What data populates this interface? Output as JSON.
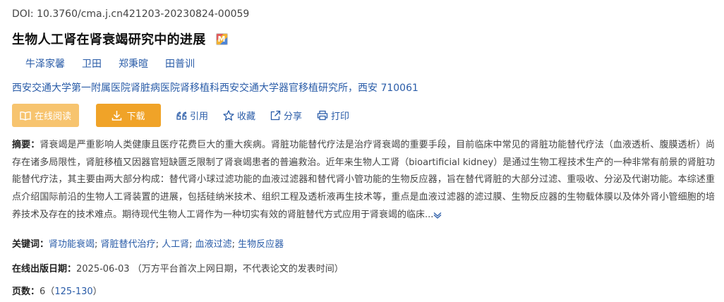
{
  "doi": "DOI: 10.3760/cma.j.cn421203-20230824-00059",
  "title": "生物人工肾在肾衰竭研究中的进展",
  "badge_letter": "M",
  "authors": [
    "牛泽家馨",
    "卫田",
    "郑秉暄",
    "田普训"
  ],
  "affiliation": "西安交通大学第一附属医院肾脏病医院肾移植科西安交通大学器官移植研究所，西安   710061",
  "actions": {
    "read": "在线阅读",
    "download": "下载",
    "cite": "引用",
    "favorite": "收藏",
    "share": "分享",
    "print": "打印"
  },
  "abstract": {
    "label": "摘要：",
    "text": "肾衰竭是严重影响人类健康且医疗花费巨大的重大疾病。肾脏功能替代疗法是治疗肾衰竭的重要手段，目前临床中常见的肾脏功能替代疗法（血液透析、腹膜透析）尚存在诸多局限性，肾脏移植又因器官短缺匮乏限制了肾衰竭患者的普遍救治。近年来生物人工肾（bioartificial kidney）是通过生物工程技术生产的一种非常有前景的肾脏功能替代疗法，其主要由两大部分构成：替代肾小球过滤功能的血液过滤器和替代肾小管功能的生物反应器，旨在替代肾脏的大部分过滤、重吸收、分泌及代谢功能。本综述重点介绍国际前沿的生物人工肾装置的进展，包括硅纳米技术、组织工程及透析液再生技术等，重点是血液过滤器的滤过膜、生物反应器的生物载体膜以及体外肾小管细胞的培养技术及存在的技术难点。期待现代生物人工肾作为一种切实有效的肾脏替代方式应用于肾衰竭的临床...",
    "expand_icon": "chevron-down-icon"
  },
  "keywords": {
    "label": "关键词：",
    "items": [
      "肾功能衰竭",
      "肾脏替代治疗",
      "人工肾",
      "血液过滤",
      "生物反应器"
    ],
    "separator": "; "
  },
  "pubdate": {
    "label": "在线出版日期：",
    "value": "2025-06-03",
    "note": "（万方平台首次上网日期，不代表论文的发表时间）"
  },
  "pages": {
    "label": "页数：",
    "count": "6",
    "open": "（",
    "range": "125-130",
    "close": "）"
  },
  "colors": {
    "link": "#2a5ca8",
    "read_button": "#f7c46f",
    "download_button": "#f0a328"
  }
}
